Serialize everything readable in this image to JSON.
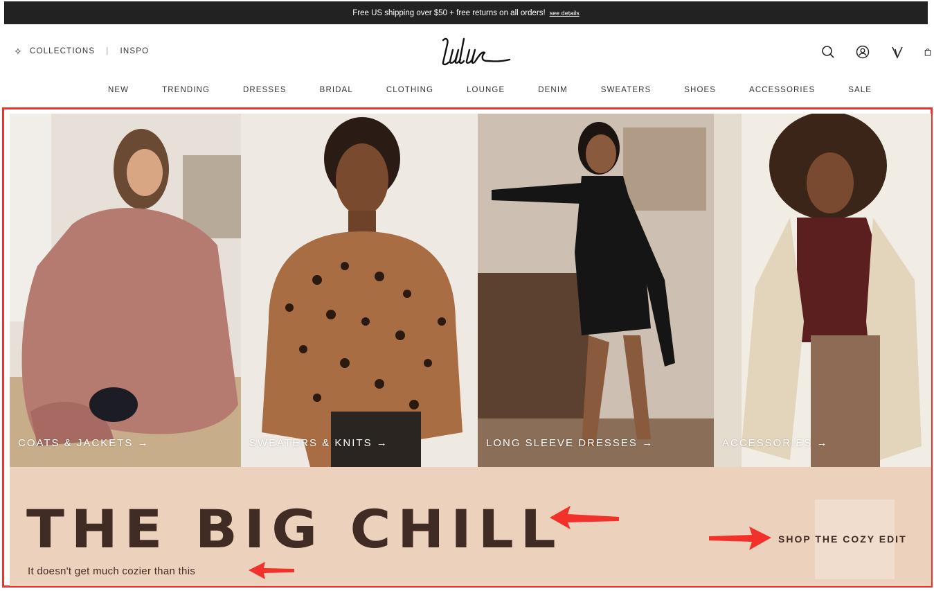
{
  "promo": {
    "text": "Free US shipping over $50 + free returns on all orders!",
    "link": "see details"
  },
  "header": {
    "collections_label": "COLLECTIONS",
    "inspo_label": "INSPO",
    "logo_text": "Lulus"
  },
  "nav": {
    "items": [
      "NEW",
      "TRENDING",
      "DRESSES",
      "BRIDAL",
      "CLOTHING",
      "LOUNGE",
      "DENIM",
      "SWEATERS",
      "SHOES",
      "ACCESSORIES",
      "SALE"
    ]
  },
  "hero": {
    "tiles": [
      {
        "label": "COATS & JACKETS →"
      },
      {
        "label": "SWEATERS & KNITS →"
      },
      {
        "label": "LONG SLEEVE DRESSES →"
      },
      {
        "label": "ACCESSORIES →"
      }
    ],
    "headline": "THE BIG CHILL",
    "subline": "It doesn't get much cozier than this",
    "cta": "SHOP THE COZY EDIT"
  },
  "colors": {
    "highlight": "#f2322a",
    "band": "#ecd2bc",
    "text_dark": "#402b25"
  }
}
